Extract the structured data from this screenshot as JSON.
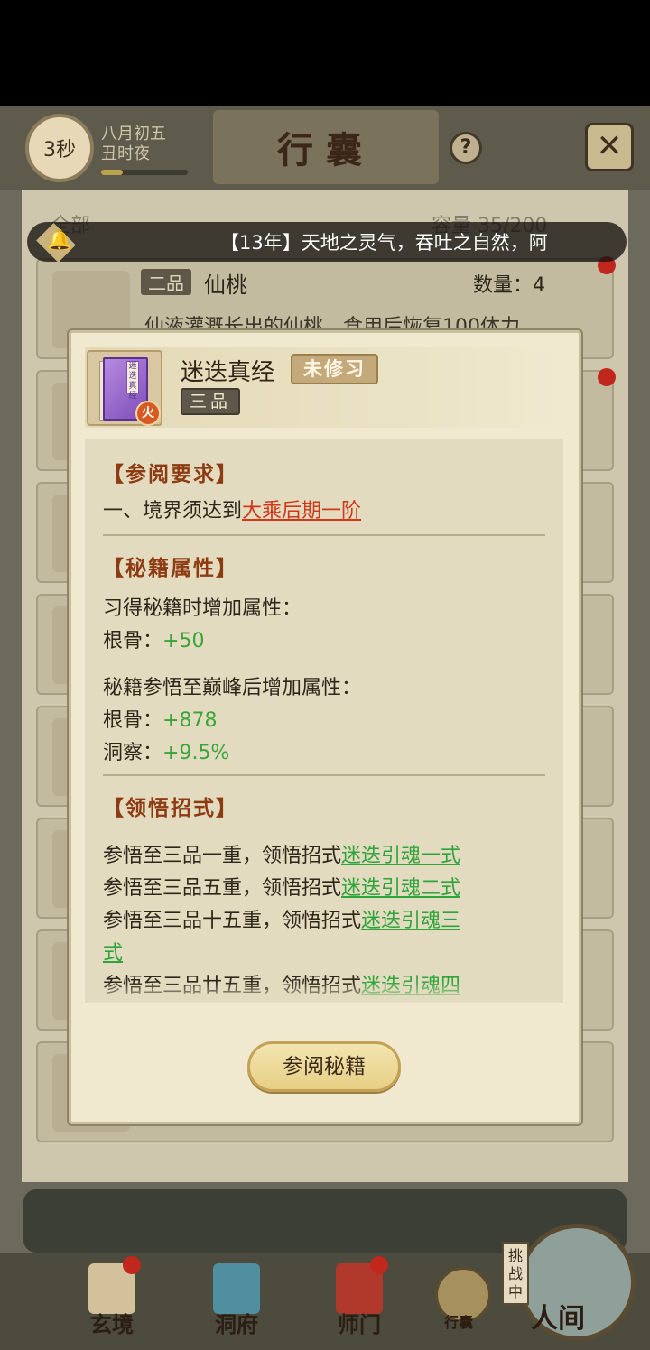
{
  "top_bar": {
    "timer": "3秒",
    "date_line1": "八月初五",
    "date_line2": "丑时夜",
    "title": "行囊",
    "help_icon": "question-icon",
    "close_icon": "close-icon"
  },
  "filter": {
    "all_label": "全部",
    "capacity": "容量 35/200"
  },
  "notice": {
    "bell_icon": "bell-icon",
    "text": "【13年】天地之灵气，吞吐之自然，阿"
  },
  "first_item": {
    "grade": "二品",
    "name": "仙桃",
    "quantity": "数量：4",
    "desc": "仙液灌溉长出的仙桃，食用后恢复100体力"
  },
  "modal": {
    "name": "迷迭真经",
    "status": "未修习",
    "grade": "三品",
    "fire_badge": "火",
    "book_cover_text": "迷迭真经",
    "sections": {
      "requirement_title": "【参阅要求】",
      "requirement_prefix": "一、境界须达到",
      "requirement_realm": "大乘后期一阶",
      "attributes_title": "【秘籍属性】",
      "learn_label": "习得秘籍时增加属性：",
      "learn_stat_label": "根骨：",
      "learn_stat_value": "+50",
      "peak_label": "秘籍参悟至巅峰后增加属性：",
      "peak_stat1_label": "根骨：",
      "peak_stat1_value": "+878",
      "peak_stat2_label": "洞察：",
      "peak_stat2_value": "+9.5%",
      "moves_title": "【领悟招式】",
      "move1_prefix": "参悟至三品一重，领悟招式",
      "move1_name": "迷迭引魂一式",
      "move2_prefix": "参悟至三品五重，领悟招式",
      "move2_name": "迷迭引魂二式",
      "move3_prefix": "参悟至三品十五重，领悟招式",
      "move3_name_a": "迷迭引魂三",
      "move3_name_b": "式",
      "move4_prefix": "参悟至三品廿五重，领悟招式",
      "move4_name": "迷迭引魂四"
    },
    "read_button": "参阅秘籍"
  },
  "bottom_nav": {
    "items": [
      {
        "label": "玄境",
        "icon": "scroll-icon"
      },
      {
        "label": "洞府",
        "icon": "pavilion-icon"
      },
      {
        "label": "师门",
        "icon": "banner-icon"
      }
    ],
    "bag_label": "行囊",
    "challenge_label": "挑战中",
    "world_label": "人间"
  },
  "colors": {
    "section_title": "#8e3b12",
    "link_red": "#d0381b",
    "value_green": "#3aa437",
    "modal_bg": "#f0e9cf",
    "panel_bg": "#e3dbc0"
  }
}
